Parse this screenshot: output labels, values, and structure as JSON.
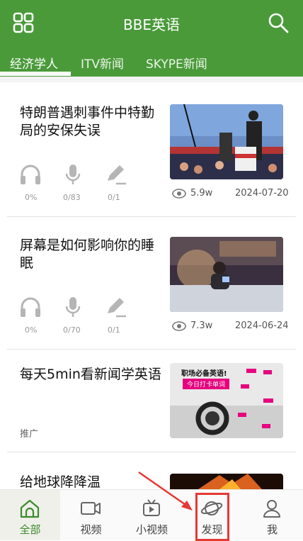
{
  "header": {
    "title": "BBE英语"
  },
  "tabs": [
    {
      "label": "经济学人"
    },
    {
      "label": "ITV新闻"
    },
    {
      "label": "SKYPE新闻"
    }
  ],
  "articles": [
    {
      "title": "特朗普遇刺事件中特勤局的安保失误",
      "listen": "0%",
      "speak": "0/83",
      "write": "0/1",
      "views": "5.9w",
      "date": "2024-07-20"
    },
    {
      "title": "屏幕是如何影响你的睡眠",
      "listen": "0%",
      "speak": "0/70",
      "write": "0/1",
      "views": "7.3w",
      "date": "2024-06-24"
    }
  ],
  "ad": {
    "title": "每天5min看新闻学英语",
    "label": "推广",
    "image_text": "职场必备英语!",
    "image_button": "今日打卡单词"
  },
  "partial_article": {
    "title": "给地球降降温"
  },
  "bottom_nav": [
    {
      "label": "全部",
      "icon": "home-icon"
    },
    {
      "label": "视频",
      "icon": "video-icon"
    },
    {
      "label": "小视频",
      "icon": "tv-icon"
    },
    {
      "label": "发现",
      "icon": "planet-icon"
    },
    {
      "label": "我",
      "icon": "user-icon"
    }
  ],
  "colors": {
    "brand": "#4a9a3a",
    "annotation": "#e53935"
  }
}
